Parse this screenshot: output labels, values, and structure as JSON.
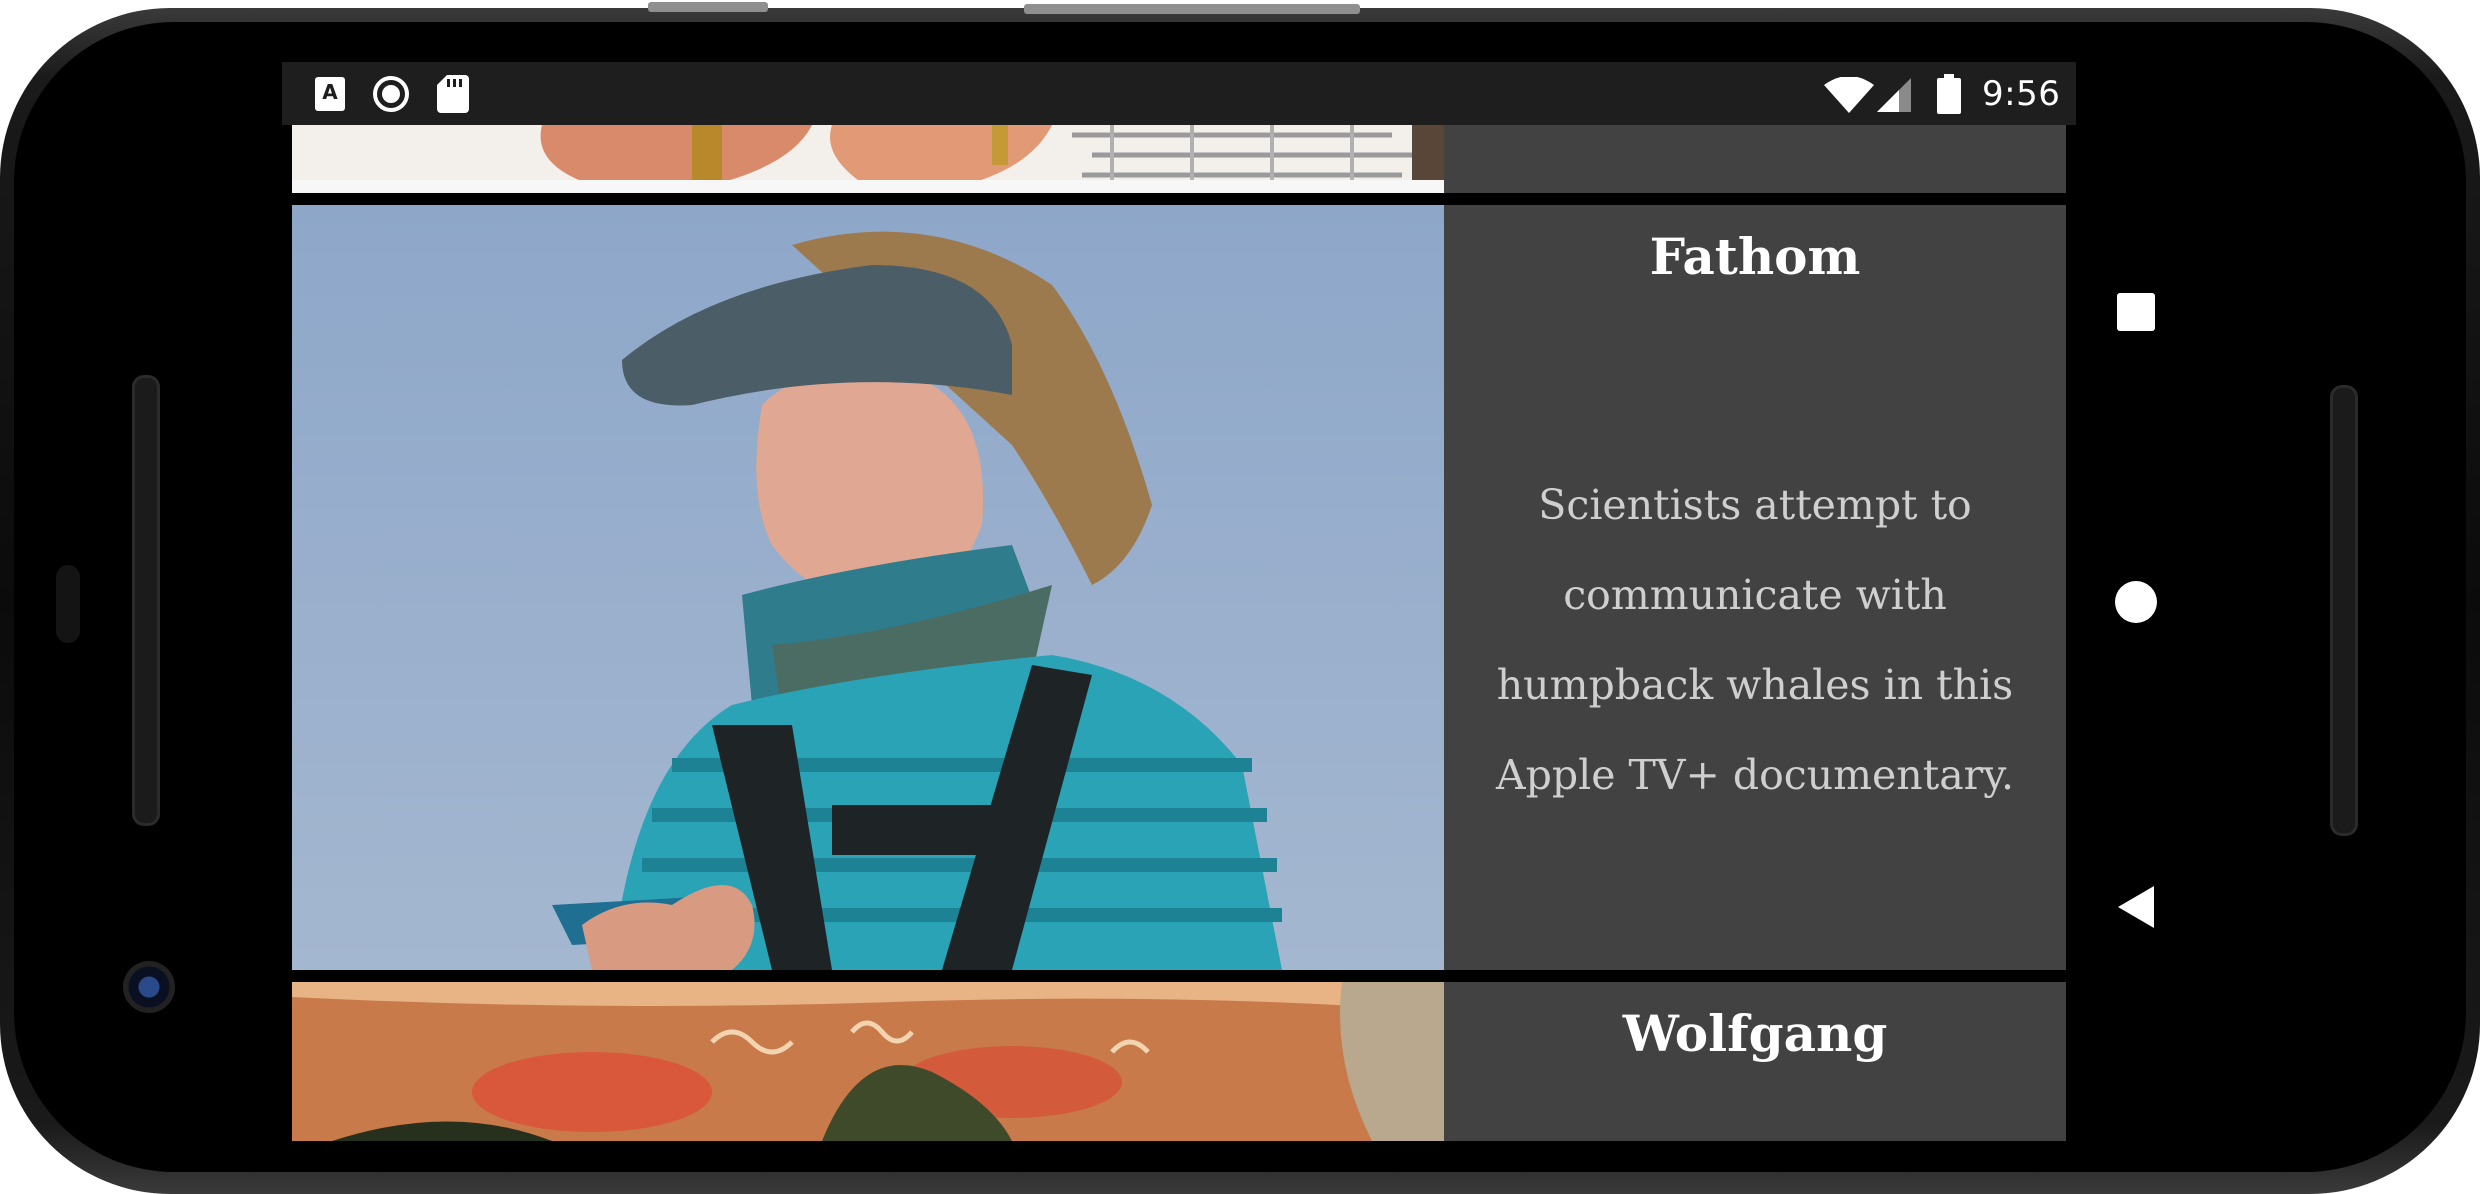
{
  "status_bar": {
    "notification_icons": [
      "a-badge-icon",
      "record-icon",
      "sd-card-icon"
    ],
    "system_icons": [
      "wifi-icon",
      "cell-signal-icon",
      "battery-icon"
    ],
    "time": "9:56"
  },
  "cards": [
    {
      "id": "previous",
      "title": "",
      "description": "",
      "image": "cropped-image-hands-on-boat"
    },
    {
      "id": "fathom",
      "title": "Fathom",
      "description": "Scientists attempt to communicate with humpback whales in this Apple TV+ documentary.",
      "image": "scientist-in-visor-photo"
    },
    {
      "id": "wolfgang",
      "title": "Wolfgang",
      "description": "",
      "image": "pizza-closeup-photo"
    }
  ],
  "nav_bar": {
    "buttons": [
      "recents-button",
      "home-button",
      "back-button"
    ]
  },
  "colors": {
    "card_text_bg": "#424242",
    "title": "#ffffff",
    "description": "#cfcfcf",
    "status_bar_bg": "#1e1e1e"
  }
}
